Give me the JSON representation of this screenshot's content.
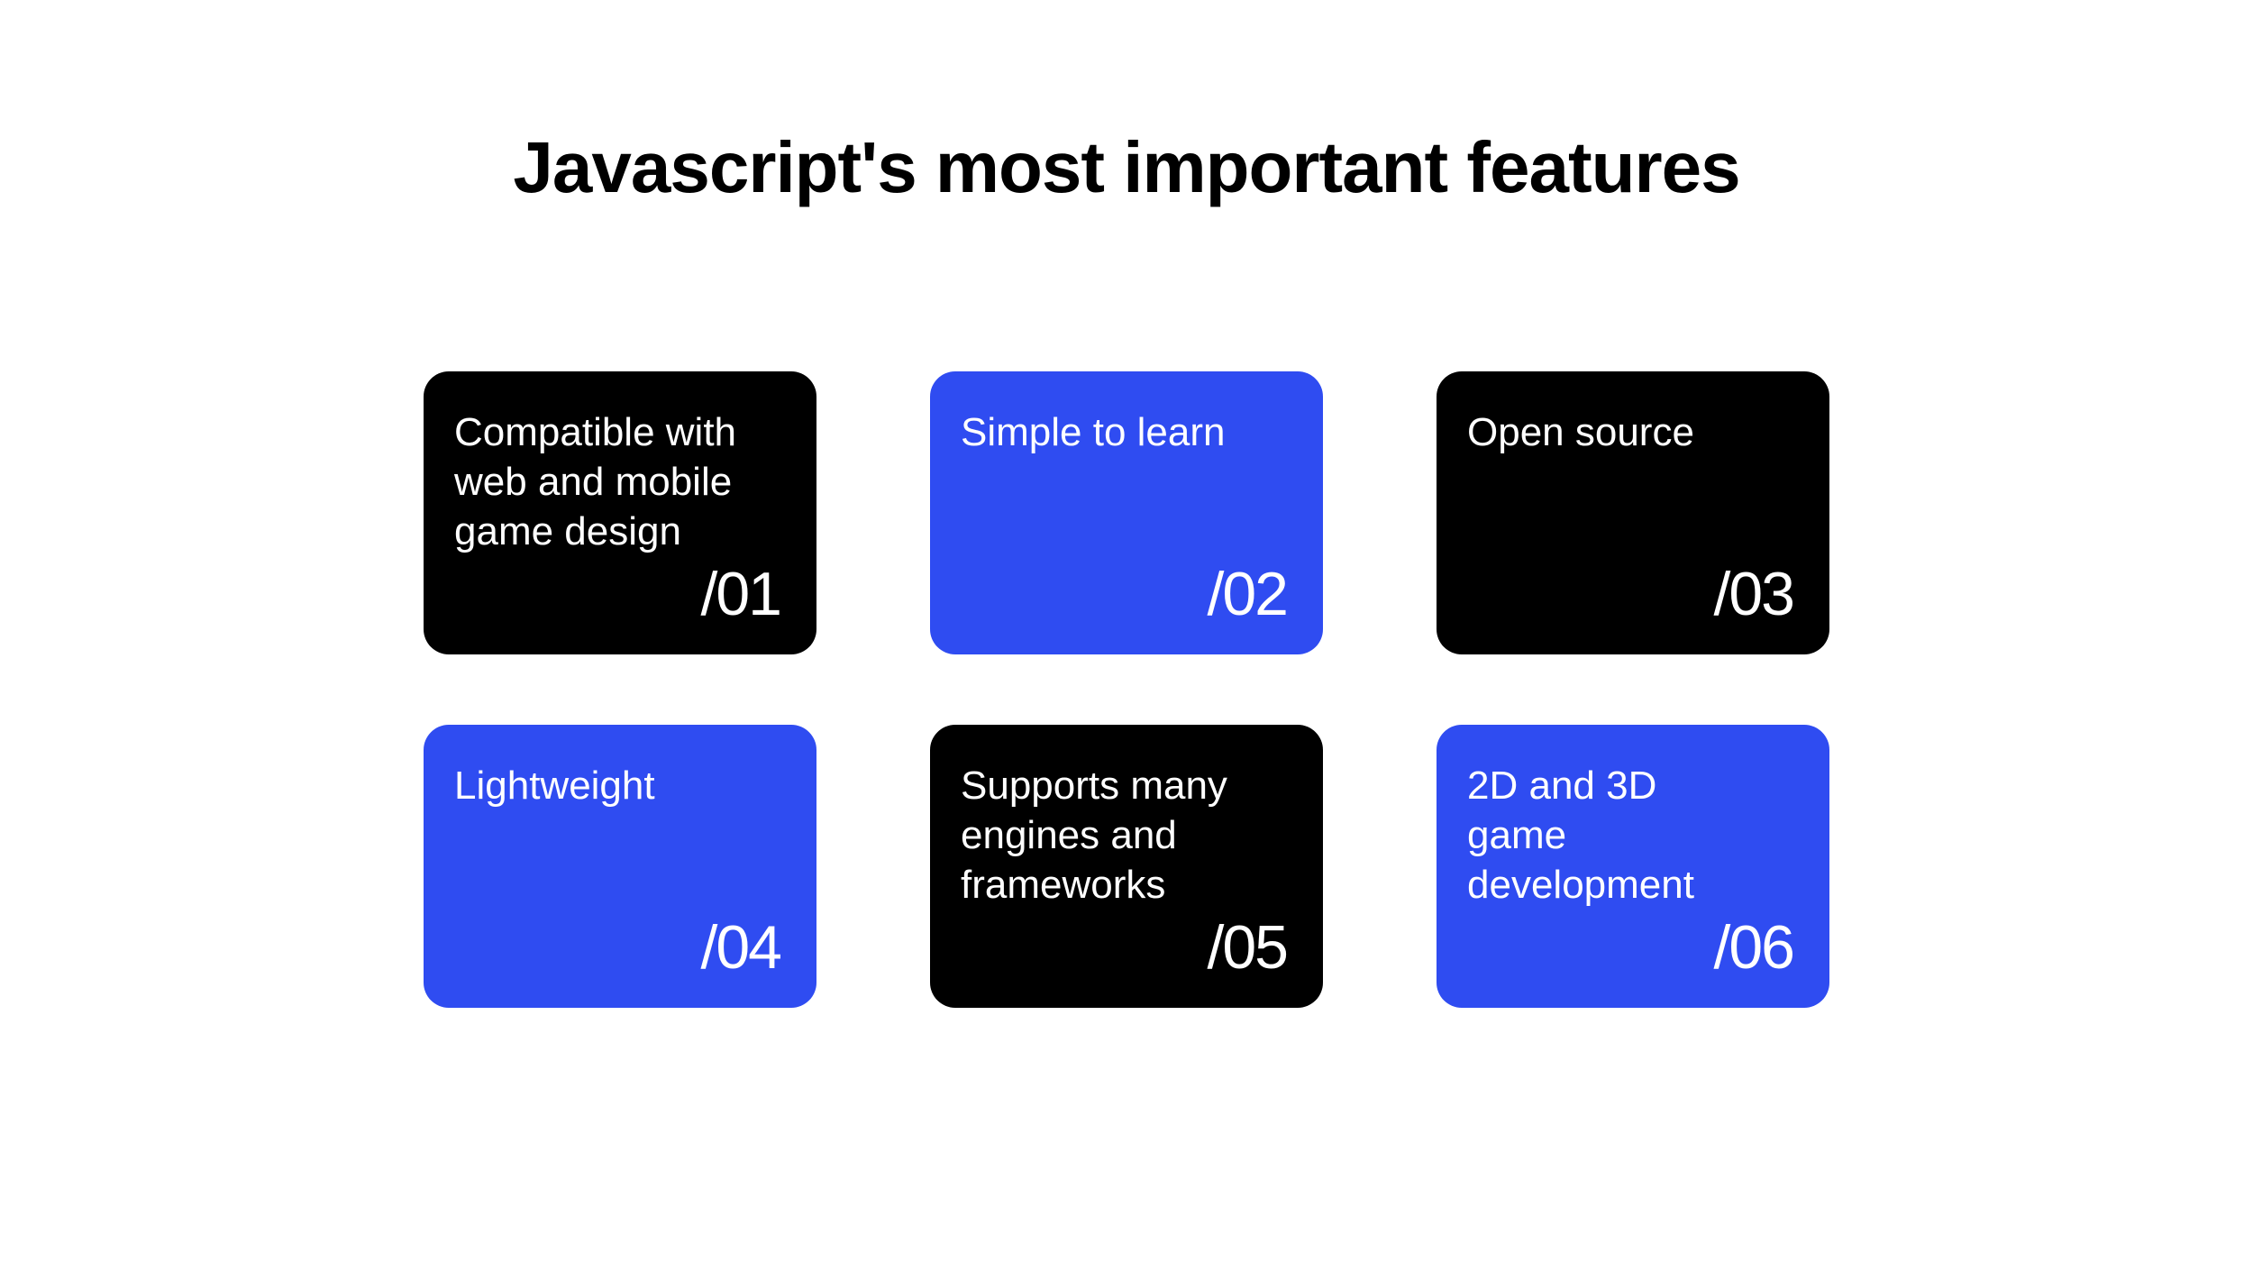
{
  "title": "Javascript's most important features",
  "colors": {
    "black": "#000000",
    "blue": "#2F4CF1",
    "white": "#ffffff"
  },
  "cards": [
    {
      "text": "Compatible with web and mobile game design",
      "number": "/01",
      "color": "black"
    },
    {
      "text": "Simple to learn",
      "number": "/02",
      "color": "blue"
    },
    {
      "text": "Open source",
      "number": "/03",
      "color": "black"
    },
    {
      "text": "Lightweight",
      "number": "/04",
      "color": "blue"
    },
    {
      "text": "Supports many engines and frameworks",
      "number": "/05",
      "color": "black"
    },
    {
      "text": "2D and 3D game development",
      "number": "/06",
      "color": "blue"
    }
  ]
}
